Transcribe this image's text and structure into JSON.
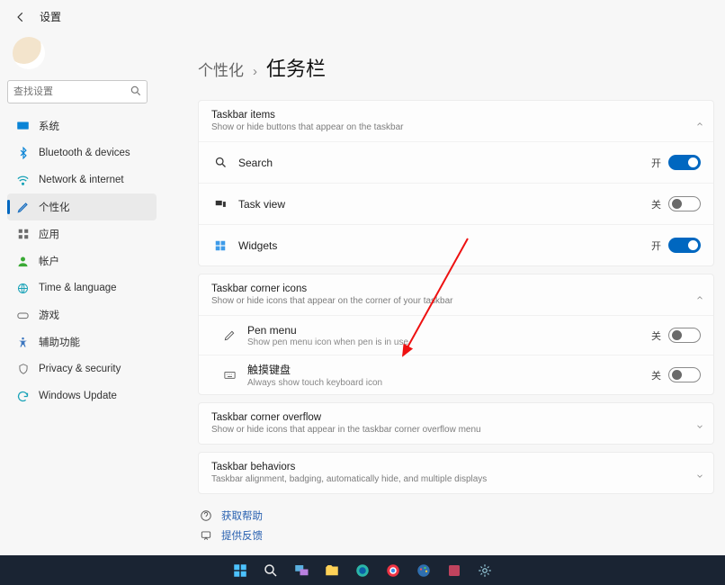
{
  "header": {
    "app_title": "设置"
  },
  "search": {
    "placeholder": "查找设置"
  },
  "sidebar": {
    "items": [
      {
        "label": "系统"
      },
      {
        "label": "Bluetooth & devices"
      },
      {
        "label": "Network & internet"
      },
      {
        "label": "个性化"
      },
      {
        "label": "应用"
      },
      {
        "label": "帐户"
      },
      {
        "label": "Time & language"
      },
      {
        "label": "游戏"
      },
      {
        "label": "辅助功能"
      },
      {
        "label": "Privacy & security"
      },
      {
        "label": "Windows Update"
      }
    ]
  },
  "breadcrumb": {
    "parent": "个性化",
    "current": "任务栏"
  },
  "sections": {
    "items": {
      "title": "Taskbar items",
      "desc": "Show or hide buttons that appear on the taskbar",
      "rows": [
        {
          "label": "Search",
          "state_text": "开",
          "on": true
        },
        {
          "label": "Task view",
          "state_text": "关",
          "on": false
        },
        {
          "label": "Widgets",
          "state_text": "开",
          "on": true
        }
      ]
    },
    "corner": {
      "title": "Taskbar corner icons",
      "desc": "Show or hide icons that appear on the corner of your taskbar",
      "rows": [
        {
          "label": "Pen menu",
          "sub": "Show pen menu icon when pen is in use",
          "state_text": "关",
          "on": false
        },
        {
          "label": "触摸键盘",
          "sub": "Always show touch keyboard icon",
          "state_text": "关",
          "on": false
        }
      ]
    },
    "overflow": {
      "title": "Taskbar corner overflow",
      "desc": "Show or hide icons that appear in the taskbar corner overflow menu"
    },
    "behaviors": {
      "title": "Taskbar behaviors",
      "desc": "Taskbar alignment, badging, automatically hide, and multiple displays"
    }
  },
  "help": {
    "a": "获取帮助",
    "b": "提供反馈"
  },
  "colors": {
    "accent": "#0067c0"
  }
}
